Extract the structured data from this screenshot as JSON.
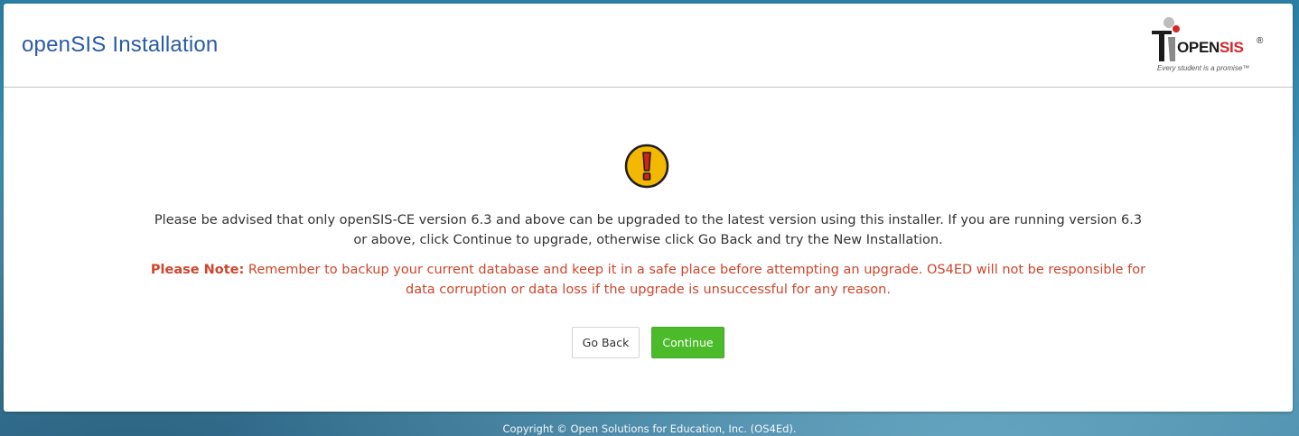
{
  "header": {
    "title": "openSIS Installation",
    "logo": {
      "word_open": "OPEN",
      "word_sis": "SIS",
      "registered": "®",
      "tagline": "Every student is a promise™"
    }
  },
  "body": {
    "icon": "warning-exclamation-icon",
    "advice_text": "Please be advised that only openSIS-CE version 6.3 and above can be upgraded to the latest version using this installer. If you are running version 6.3 or above, click Continue to upgrade, otherwise click Go Back and try the New Installation.",
    "note_label": "Please Note:",
    "note_text": " Remember to backup your current database and keep it in a safe place before attempting an upgrade. OS4ED will not be responsible for data corruption or data loss if the upgrade is unsuccessful for any reason."
  },
  "buttons": {
    "go_back": "Go Back",
    "continue": "Continue"
  },
  "footer": {
    "copyright": "Copyright © Open Solutions for Education, Inc. (OS4Ed)."
  },
  "colors": {
    "title": "#2a5aa8",
    "note": "#d0452c",
    "continue_button": "#4cbb2a",
    "warning_fill": "#f5b800",
    "warning_mark": "#d3221c"
  }
}
